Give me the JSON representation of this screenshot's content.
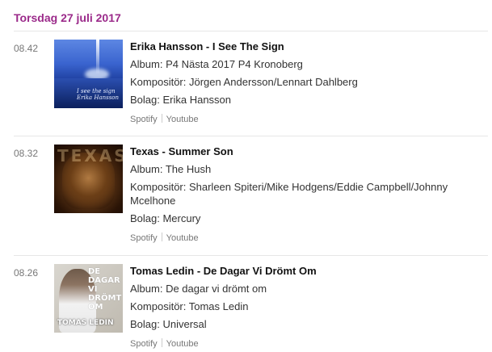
{
  "date_heading": "Torsdag 27 juli 2017",
  "colors": {
    "accent": "#9b2a8a",
    "rule": "#e6e6e6",
    "muted": "#777777"
  },
  "tracks": [
    {
      "time": "08.42",
      "title": "Erika Hansson - I See The Sign",
      "album": "Album: P4 Nästa 2017 P4 Kronoberg",
      "composer": "Kompositör: Jörgen Andersson/Lennart Dahlberg",
      "label": "Bolag: Erika Hansson",
      "links": [
        "Spotify",
        "Youtube"
      ],
      "cover_text": "I see the sign\nErika Hansson"
    },
    {
      "time": "08.32",
      "title": "Texas - Summer Son",
      "album": "Album: The Hush",
      "composer": "Kompositör: Sharleen Spiteri/Mike Hodgens/Eddie Campbell/Johnny Mcelhone",
      "label": "Bolag: Mercury",
      "links": [
        "Spotify",
        "Youtube"
      ],
      "cover_text": "TEXAS"
    },
    {
      "time": "08.26",
      "title": "Tomas Ledin - De Dagar Vi Drömt Om",
      "album": "Album: De dagar vi drömt om",
      "composer": "Kompositör: Tomas Ledin",
      "label": "Bolag: Universal",
      "links": [
        "Spotify",
        "Youtube"
      ],
      "cover_text": "DE DAGAR VI DRÖMT OM",
      "cover_name": "TOMAS LEDIN"
    }
  ]
}
